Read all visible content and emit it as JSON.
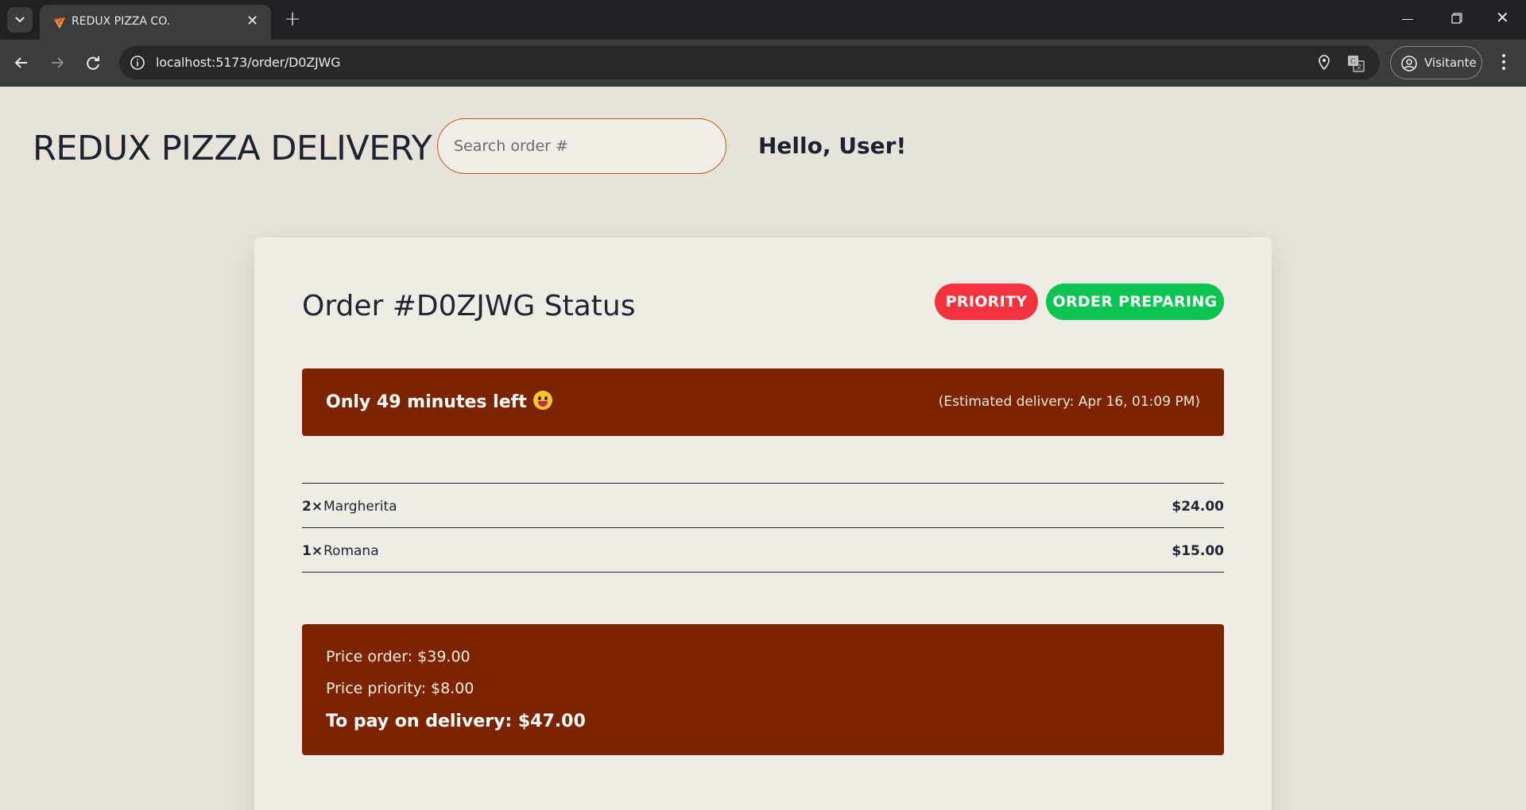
{
  "browser": {
    "tab_title": "REDUX PIZZA CO.",
    "url": "localhost:5173/order/D0ZJWG",
    "profile_label": "Visitante"
  },
  "header": {
    "brand": "REDUX PIZZA DELIVERY",
    "search_placeholder": "Search order #",
    "greeting": "Hello, User!"
  },
  "order": {
    "title": "Order #D0ZJWG Status",
    "badges": {
      "priority": "PRIORITY",
      "status": "ORDER PREPARING"
    },
    "eta_text": "Only 49 minutes left",
    "eta_detail": "(Estimated delivery: Apr 16, 01:09 PM)",
    "items": [
      {
        "qty": "2×",
        "name": "Margherita",
        "price": "$24.00"
      },
      {
        "qty": "1×",
        "name": "Romana",
        "price": "$15.00"
      }
    ],
    "price_order": "Price order: $39.00",
    "price_priority": "Price priority: $8.00",
    "to_pay": "To pay on delivery: $47.00"
  },
  "colors": {
    "accent_brown": "#7c2400",
    "priority_red": "#f5333f",
    "status_green": "#0ac550",
    "page_bg": "#e8e3da"
  }
}
